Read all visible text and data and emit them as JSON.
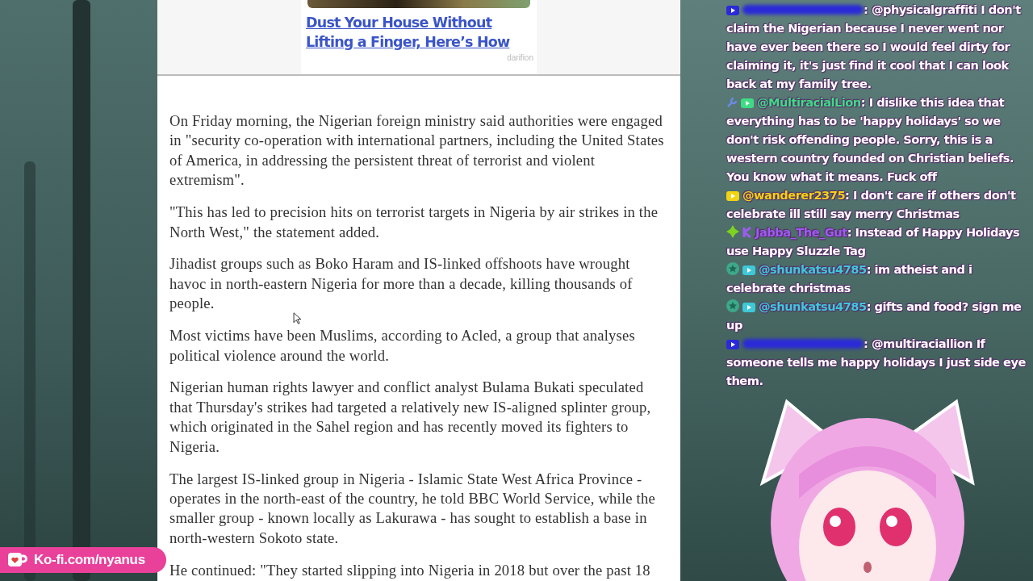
{
  "ad": {
    "headline": "Dust Your House Without Lifting a Finger, Here’s How",
    "source": "darifion"
  },
  "article": {
    "paragraphs": [
      "On Friday morning, the Nigerian foreign ministry said authorities were engaged in \"security co-operation with international partners, including the United States of America, in addressing the persistent threat of terrorist and violent extremism\".",
      "\"This has led to precision hits on terrorist targets in Nigeria by air strikes in the North West,\" the statement added.",
      "Jihadist groups such as Boko Haram and IS-linked offshoots have wrought havoc in north-eastern Nigeria for more than a decade, killing thousands of people.",
      "Most victims have been Muslims, according to Acled, a group that analyses political violence around the world.",
      "Nigerian human rights lawyer and conflict analyst Bulama Bukati speculated that Thursday's strikes had targeted a relatively new IS-aligned splinter group, which originated in the Sahel region and has recently moved its fighters to Nigeria.",
      "The largest IS-linked group in Nigeria - Islamic State West Africa Province - operates in the north-east of the country, he told BBC World Service, while the smaller group - known locally as Lakurawa - has sought to establish a base in north-western Sokoto state.",
      "He continued: \"They started slipping into Nigeria in 2018 but over the past 18"
    ]
  },
  "chat": {
    "messages": [
      {
        "badges": [
          {
            "kind": "youtube"
          }
        ],
        "author_blurred": true,
        "color": "#2a2ad8",
        "text": ": @physicalgraffiti I don't claim the Nigerian because I never went nor have ever been there so I would feel dirty for claiming it, it's just find it cool that I can look back at my family tree."
      },
      {
        "badges": [
          {
            "kind": "wrench"
          },
          {
            "kind": "youtube"
          }
        ],
        "author_blurred": false,
        "author": "@MultiracialLion",
        "color": "#3ddc84",
        "text": ": I dislike this idea that everything has to be 'happy holidays' so we don't risk offending people. Sorry, this is a western country founded on Christian beliefs. You know what it means. Fuck off"
      },
      {
        "badges": [
          {
            "kind": "youtube"
          }
        ],
        "author_blurred": false,
        "author": "@wanderer2375",
        "color": "#f2d413",
        "text": ": I don't care if others don't celebrate ill still say merry Christmas"
      },
      {
        "badges": [
          {
            "kind": "diamond"
          },
          {
            "kind": "twitch"
          }
        ],
        "author_blurred": false,
        "author": "Jabba_The_Gut",
        "color": "#9b5cf0",
        "text": ": Instead of Happy Holidays use Happy Sluzzle Tag"
      },
      {
        "badges": [
          {
            "kind": "star"
          },
          {
            "kind": "youtube"
          }
        ],
        "author_blurred": false,
        "author": "@shunkatsu4785",
        "color": "#3ec8d8",
        "text": ": im atheist and i celebrate christmas"
      },
      {
        "badges": [
          {
            "kind": "star"
          },
          {
            "kind": "youtube"
          }
        ],
        "author_blurred": false,
        "author": "@shunkatsu4785",
        "color": "#3ec8d8",
        "text": ": gifts and food? sign me up"
      },
      {
        "badges": [
          {
            "kind": "youtube"
          }
        ],
        "author_blurred": true,
        "color": "#2a2ad8",
        "text": ": @multiraciallion If someone tells me happy holidays I just side eye them."
      }
    ]
  },
  "kofi": {
    "label": "Ko-fi.com/nyanus"
  }
}
